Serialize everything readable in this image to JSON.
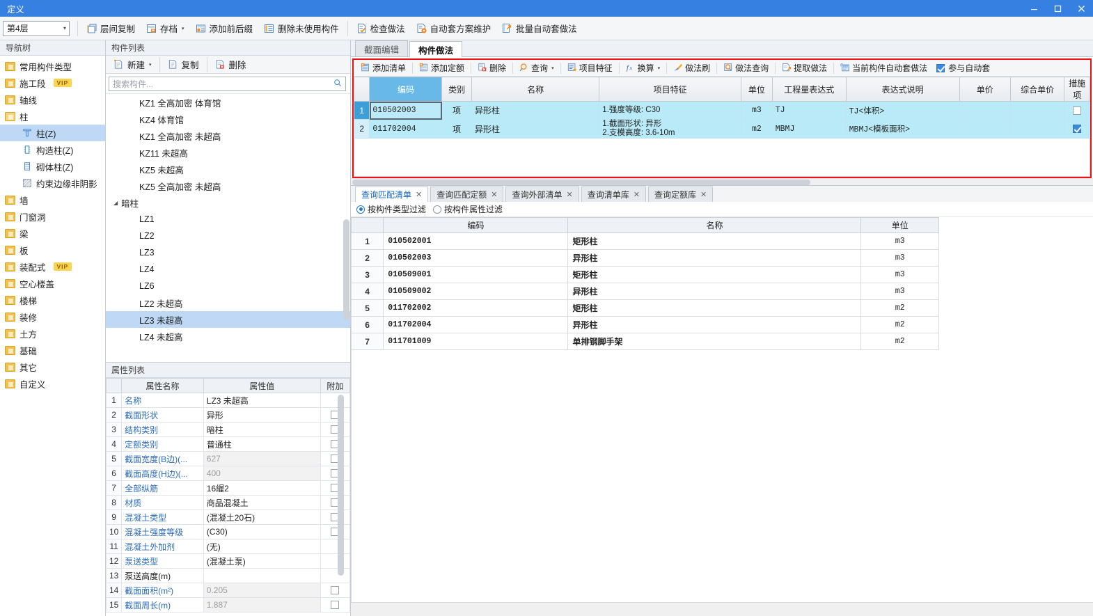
{
  "window": {
    "title": "定义",
    "minimize": "—",
    "maximize": "▢",
    "close": "✕"
  },
  "main_toolbar": {
    "floor_select": {
      "value": "第4层",
      "arrow": "▾"
    },
    "buttons": [
      {
        "label": "层间复制",
        "icon": "copy-between-floors-icon",
        "caret": ""
      },
      {
        "label": "存档",
        "icon": "archive-icon",
        "caret": "▾"
      },
      {
        "label": "添加前后缀",
        "icon": "add-affix-icon",
        "caret": ""
      },
      {
        "label": "删除未使用构件",
        "icon": "delete-unused-icon",
        "caret": ""
      },
      {
        "label": "检查做法",
        "icon": "check-method-icon",
        "caret": ""
      },
      {
        "label": "自动套方案维护",
        "icon": "auto-scheme-icon",
        "caret": ""
      },
      {
        "label": "批量自动套做法",
        "icon": "batch-auto-icon",
        "caret": ""
      }
    ]
  },
  "nav_tree": {
    "header": "导航树",
    "items": [
      {
        "label": "常用构件类型",
        "icon": "folder-icon",
        "level": 0,
        "selected": false,
        "vip": false
      },
      {
        "label": "施工段",
        "icon": "folder-icon",
        "level": 0,
        "selected": false,
        "vip": true,
        "vip_label": "VIP"
      },
      {
        "label": "轴线",
        "icon": "folder-icon",
        "level": 0,
        "selected": false,
        "vip": false
      },
      {
        "label": "柱",
        "icon": "folder-open-icon",
        "level": 0,
        "selected": false,
        "vip": false
      },
      {
        "label": "柱(Z)",
        "icon": "column-icon",
        "level": 1,
        "selected": true,
        "vip": false
      },
      {
        "label": "构造柱(Z)",
        "icon": "constructional-column-icon",
        "level": 1,
        "selected": false,
        "vip": false
      },
      {
        "label": "砌体柱(Z)",
        "icon": "masonry-column-icon",
        "level": 1,
        "selected": false,
        "vip": false
      },
      {
        "label": "约束边缘非阴影",
        "icon": "edge-nonshadow-icon",
        "level": 1,
        "selected": false,
        "vip": false
      },
      {
        "label": "墙",
        "icon": "folder-icon",
        "level": 0,
        "selected": false,
        "vip": false
      },
      {
        "label": "门窗洞",
        "icon": "folder-icon",
        "level": 0,
        "selected": false,
        "vip": false
      },
      {
        "label": "梁",
        "icon": "folder-icon",
        "level": 0,
        "selected": false,
        "vip": false
      },
      {
        "label": "板",
        "icon": "folder-icon",
        "level": 0,
        "selected": false,
        "vip": false
      },
      {
        "label": "装配式",
        "icon": "folder-icon",
        "level": 0,
        "selected": false,
        "vip": true,
        "vip_label": "VIP"
      },
      {
        "label": "空心楼盖",
        "icon": "folder-icon",
        "level": 0,
        "selected": false,
        "vip": false
      },
      {
        "label": "楼梯",
        "icon": "folder-icon",
        "level": 0,
        "selected": false,
        "vip": false
      },
      {
        "label": "装修",
        "icon": "folder-icon",
        "level": 0,
        "selected": false,
        "vip": false
      },
      {
        "label": "土方",
        "icon": "folder-icon",
        "level": 0,
        "selected": false,
        "vip": false
      },
      {
        "label": "基础",
        "icon": "folder-icon",
        "level": 0,
        "selected": false,
        "vip": false
      },
      {
        "label": "其它",
        "icon": "folder-icon",
        "level": 0,
        "selected": false,
        "vip": false
      },
      {
        "label": "自定义",
        "icon": "folder-icon",
        "level": 0,
        "selected": false,
        "vip": false
      }
    ]
  },
  "component_list": {
    "header": "构件列表",
    "toolbar": [
      {
        "label": "新建",
        "icon": "new-icon",
        "caret": "▾"
      },
      {
        "label": "复制",
        "icon": "copy-icon",
        "caret": ""
      },
      {
        "label": "删除",
        "icon": "delete-icon",
        "caret": ""
      }
    ],
    "search": {
      "placeholder": "搜索构件...",
      "icon": "search-icon"
    },
    "items": [
      {
        "label": "KZ1 全高加密 体育馆",
        "group": false,
        "selected": false
      },
      {
        "label": "KZ4 体育馆",
        "group": false,
        "selected": false
      },
      {
        "label": "KZ1 全高加密 未超高",
        "group": false,
        "selected": false
      },
      {
        "label": "KZ11 未超高",
        "group": false,
        "selected": false
      },
      {
        "label": "KZ5 未超高",
        "group": false,
        "selected": false
      },
      {
        "label": "KZ5 全高加密 未超高",
        "group": false,
        "selected": false
      },
      {
        "label": "暗柱",
        "group": true,
        "selected": false,
        "tri": "◢"
      },
      {
        "label": "LZ1",
        "group": false,
        "selected": false
      },
      {
        "label": "LZ2",
        "group": false,
        "selected": false
      },
      {
        "label": "LZ3",
        "group": false,
        "selected": false
      },
      {
        "label": "LZ4",
        "group": false,
        "selected": false
      },
      {
        "label": "LZ6",
        "group": false,
        "selected": false
      },
      {
        "label": "LZ2 未超高",
        "group": false,
        "selected": false
      },
      {
        "label": "LZ3 未超高",
        "group": false,
        "selected": true
      },
      {
        "label": "LZ4 未超高",
        "group": false,
        "selected": false
      }
    ]
  },
  "property_list": {
    "header": "属性列表",
    "columns": [
      "属性名称",
      "属性值",
      "附加"
    ],
    "rows": [
      {
        "n": "1",
        "name": "名称",
        "value": "LZ3 未超高",
        "grey": false,
        "attach": null,
        "link": true
      },
      {
        "n": "2",
        "name": "截面形状",
        "value": "异形",
        "grey": false,
        "attach": false,
        "link": true
      },
      {
        "n": "3",
        "name": "结构类别",
        "value": "暗柱",
        "grey": false,
        "attach": false,
        "link": true
      },
      {
        "n": "4",
        "name": "定额类别",
        "value": "普通柱",
        "grey": false,
        "attach": false,
        "link": true
      },
      {
        "n": "5",
        "name": "截面宽度(B边)(...",
        "value": "627",
        "grey": true,
        "attach": false,
        "link": true
      },
      {
        "n": "6",
        "name": "截面高度(H边)(...",
        "value": "400",
        "grey": true,
        "attach": false,
        "link": true
      },
      {
        "n": "7",
        "name": "全部纵筋",
        "value": "16䌂2",
        "grey": false,
        "attach": false,
        "link": true
      },
      {
        "n": "8",
        "name": "材质",
        "value": "商品混凝土",
        "grey": false,
        "attach": false,
        "link": true
      },
      {
        "n": "9",
        "name": "混凝土类型",
        "value": "(混凝土20石)",
        "grey": false,
        "attach": false,
        "link": true
      },
      {
        "n": "10",
        "name": "混凝土强度等级",
        "value": "(C30)",
        "grey": false,
        "attach": false,
        "link": true
      },
      {
        "n": "11",
        "name": "混凝土外加剂",
        "value": "(无)",
        "grey": false,
        "attach": null,
        "link": true
      },
      {
        "n": "12",
        "name": "泵送类型",
        "value": "(混凝土泵)",
        "grey": false,
        "attach": null,
        "link": true
      },
      {
        "n": "13",
        "name": "泵送高度(m)",
        "value": "",
        "grey": false,
        "attach": null,
        "link": false
      },
      {
        "n": "14",
        "name": "截面面积(m²)",
        "value": "0.205",
        "grey": true,
        "attach": false,
        "link": true
      },
      {
        "n": "15",
        "name": "截面周长(m)",
        "value": "1.887",
        "grey": true,
        "attach": false,
        "link": true
      }
    ]
  },
  "right_panel": {
    "tabs": [
      {
        "label": "截面编辑",
        "active": false
      },
      {
        "label": "构件做法",
        "active": true
      }
    ],
    "action_toolbar": [
      {
        "label": "添加清单",
        "icon": "add-list-icon",
        "caret": ""
      },
      {
        "label": "添加定额",
        "icon": "add-quota-icon",
        "caret": ""
      },
      {
        "label": "删除",
        "icon": "delete-icon",
        "caret": ""
      },
      {
        "label": "查询",
        "icon": "search-icon",
        "caret": "▾"
      },
      {
        "label": "项目特征",
        "icon": "project-feature-icon",
        "caret": ""
      },
      {
        "label": "换算",
        "icon": "fx-icon",
        "caret": "▾"
      },
      {
        "label": "做法刷",
        "icon": "method-brush-icon",
        "caret": ""
      },
      {
        "label": "做法查询",
        "icon": "method-query-icon",
        "caret": ""
      },
      {
        "label": "提取做法",
        "icon": "extract-method-icon",
        "caret": ""
      },
      {
        "label": "当前构件自动套做法",
        "icon": "auto-apply-icon",
        "caret": ""
      }
    ],
    "auto_checkbox": {
      "label": "参与自动套",
      "checked": true
    },
    "grid": {
      "columns": [
        "编码",
        "类别",
        "名称",
        "项目特征",
        "单位",
        "工程量表达式",
        "表达式说明",
        "单价",
        "综合单价",
        "措施项"
      ],
      "selected_column": "编码",
      "rows": [
        {
          "n": "1",
          "code": "010502003",
          "category": "项",
          "name": "异形柱",
          "feature": [
            "1.强度等级: C30"
          ],
          "unit": "m3",
          "expr": "TJ",
          "expr_desc": "TJ<体积>",
          "unit_price": "",
          "comp_price": "",
          "measure": false,
          "current": true
        },
        {
          "n": "2",
          "code": "011702004",
          "category": "项",
          "name": "异形柱",
          "feature": [
            "1.截面形状: 异形",
            "2.支模高度: 3.6-10m"
          ],
          "unit": "m2",
          "expr": "MBMJ",
          "expr_desc": "MBMJ<模板面积>",
          "unit_price": "",
          "comp_price": "",
          "measure": true,
          "current": false
        }
      ]
    }
  },
  "query_panel": {
    "tabs": [
      {
        "label": "查询匹配清单",
        "active": true,
        "close": "✕"
      },
      {
        "label": "查询匹配定额",
        "active": false,
        "close": "✕"
      },
      {
        "label": "查询外部清单",
        "active": false,
        "close": "✕"
      },
      {
        "label": "查询清单库",
        "active": false,
        "close": "✕"
      },
      {
        "label": "查询定额库",
        "active": false,
        "close": "✕"
      }
    ],
    "filters": [
      {
        "label": "按构件类型过滤",
        "selected": true
      },
      {
        "label": "按构件属性过滤",
        "selected": false
      }
    ],
    "columns": [
      "编码",
      "名称",
      "单位"
    ],
    "rows": [
      {
        "n": "1",
        "code": "010502001",
        "name": "矩形柱",
        "unit": "m3"
      },
      {
        "n": "2",
        "code": "010502003",
        "name": "异形柱",
        "unit": "m3"
      },
      {
        "n": "3",
        "code": "010509001",
        "name": "矩形柱",
        "unit": "m3"
      },
      {
        "n": "4",
        "code": "010509002",
        "name": "异形柱",
        "unit": "m3"
      },
      {
        "n": "5",
        "code": "011702002",
        "name": "矩形柱",
        "unit": "m2"
      },
      {
        "n": "6",
        "code": "011702004",
        "name": "异形柱",
        "unit": "m2"
      },
      {
        "n": "7",
        "code": "011701009",
        "name": "单排钢脚手架",
        "unit": "m2"
      }
    ]
  },
  "colors": {
    "title_bar": "#3580e0",
    "selection": "#bed8f5",
    "grid_row": "#b8eaf7",
    "highlight_border": "#ee1111",
    "link_text": "#2b6cb9"
  }
}
